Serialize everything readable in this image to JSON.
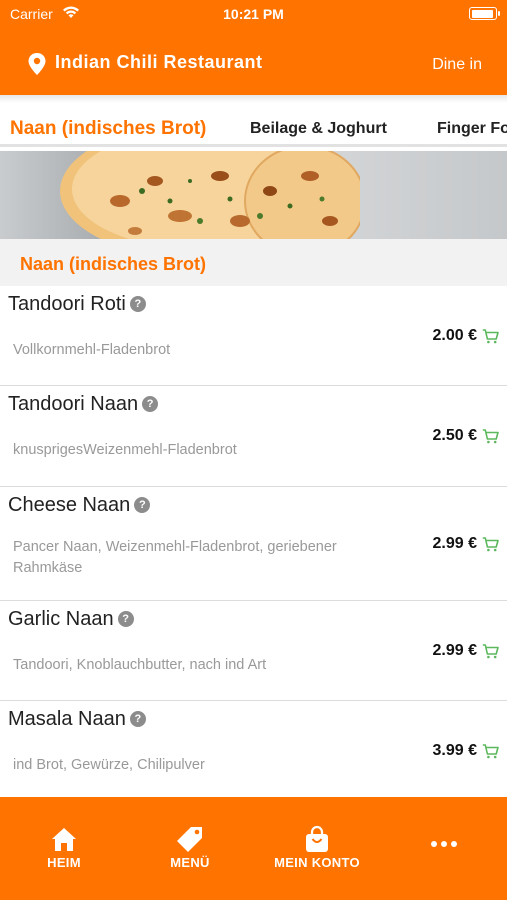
{
  "status_bar": {
    "carrier": "Carrier",
    "time": "10:21 PM"
  },
  "header": {
    "restaurant_name": "Indian Chili Restaurant",
    "mode": "Dine in"
  },
  "category_tabs": [
    {
      "label": "Naan (indisches Brot)",
      "active": true
    },
    {
      "label": "Beilage & Joghurt",
      "active": false
    },
    {
      "label": "Finger Fo",
      "active": false
    }
  ],
  "section": {
    "title": "Naan (indisches Brot)"
  },
  "menu_items": [
    {
      "name": "Tandoori Roti",
      "description": "Vollkornmehl-Fladenbrot",
      "price": "2.00 €"
    },
    {
      "name": "Tandoori Naan",
      "description": "knusprigesWeizenmehl-Fladenbrot",
      "price": "2.50 €"
    },
    {
      "name": "Cheese Naan",
      "description": "Pancer Naan, Weizenmehl-Fladenbrot, geriebener Rahmkäse",
      "price": "2.99 €"
    },
    {
      "name": "Garlic Naan",
      "description": "Tandoori, Knoblauchbutter, nach ind Art",
      "price": "2.99 €"
    },
    {
      "name": "Masala Naan",
      "description": "ind Brot, Gewürze, Chilipulver",
      "price": "3.99 €"
    }
  ],
  "help_icon_glyph": "?",
  "bottom_nav": [
    {
      "label": "HEIM",
      "icon": "home-icon"
    },
    {
      "label": "MENÜ",
      "icon": "tag-icon"
    },
    {
      "label": "MEIN KONTO",
      "icon": "shopping-bag-icon"
    },
    {
      "label": "",
      "icon": "more-icon"
    }
  ],
  "colors": {
    "brand": "#FF7300",
    "cart": "#5CB85C",
    "section_bg": "#F2F2F2"
  }
}
